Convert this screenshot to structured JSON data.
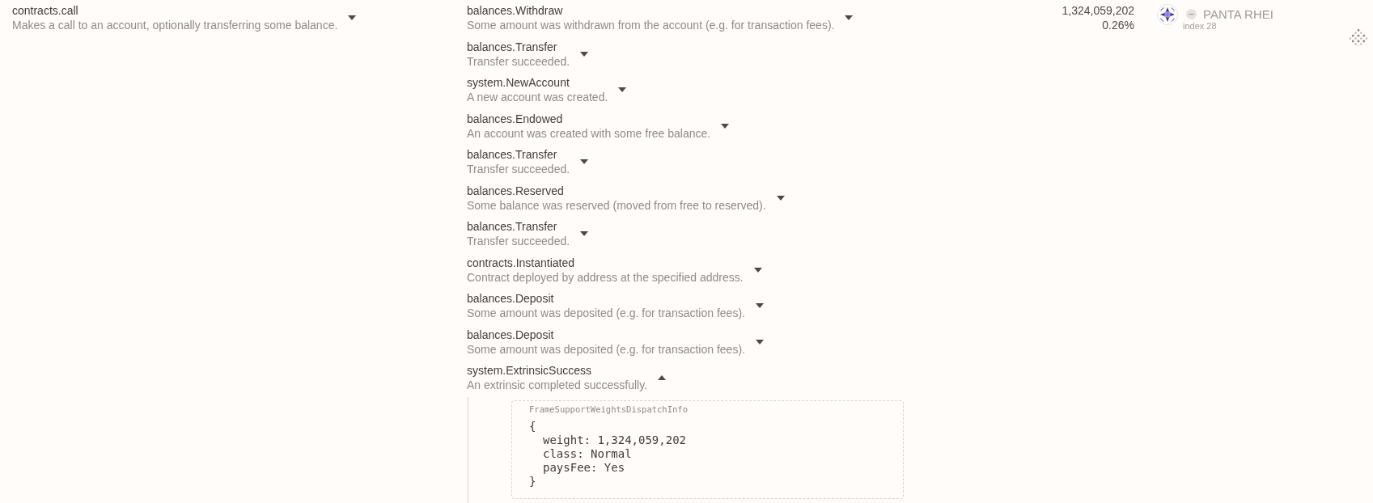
{
  "extrinsic": {
    "name": "contracts.call",
    "description": "Makes a call to an account, optionally transferring some balance.",
    "expanded": false
  },
  "events": [
    {
      "name": "balances.Withdraw",
      "description": "Some amount was withdrawn from the account (e.g. for transaction fees).",
      "expanded": false
    },
    {
      "name": "balances.Transfer",
      "description": "Transfer succeeded.",
      "expanded": false
    },
    {
      "name": "system.NewAccount",
      "description": "A new account was created.",
      "expanded": false
    },
    {
      "name": "balances.Endowed",
      "description": "An account was created with some free balance.",
      "expanded": false
    },
    {
      "name": "balances.Transfer",
      "description": "Transfer succeeded.",
      "expanded": false
    },
    {
      "name": "balances.Reserved",
      "description": "Some balance was reserved (moved from free to reserved).",
      "expanded": false
    },
    {
      "name": "balances.Transfer",
      "description": "Transfer succeeded.",
      "expanded": false
    },
    {
      "name": "contracts.Instantiated",
      "description": "Contract deployed by address at the specified address.",
      "expanded": false
    },
    {
      "name": "balances.Deposit",
      "description": "Some amount was deposited (e.g. for transaction fees).",
      "expanded": false
    },
    {
      "name": "balances.Deposit",
      "description": "Some amount was deposited (e.g. for transaction fees).",
      "expanded": false
    },
    {
      "name": "system.ExtrinsicSuccess",
      "description": "An extrinsic completed successfully.",
      "expanded": true,
      "details": {
        "type": "FrameSupportWeightsDispatchInfo",
        "open": "{",
        "fields": [
          "weight: 1,324,059,202",
          "class: Normal",
          "paysFee: Yes"
        ],
        "close": "}"
      }
    }
  ],
  "weight": {
    "value": "1,324,059,202",
    "share": "0.26%"
  },
  "signer": {
    "name": "PANTA RHEI",
    "index": "index 28"
  }
}
